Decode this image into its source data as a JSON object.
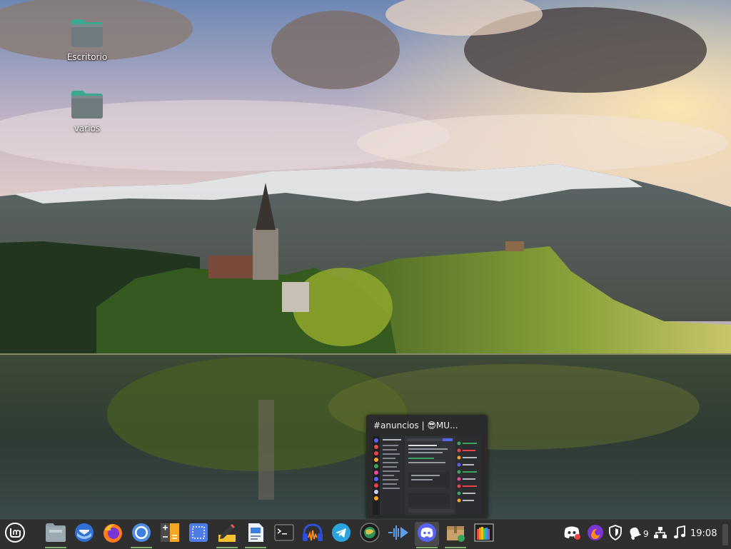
{
  "desktop": {
    "icons": [
      {
        "label": "Escritorio",
        "icon": "folder-icon"
      },
      {
        "label": "varios",
        "icon": "folder-icon"
      }
    ]
  },
  "window_preview": {
    "title": "#anuncios | 😎MU..."
  },
  "panel": {
    "menu": {
      "icon": "linux-mint-menu-icon"
    },
    "launchers": [
      {
        "name": "files",
        "icon": "folder-icon",
        "running": true
      },
      {
        "name": "thunderbird",
        "icon": "thunderbird-icon",
        "running": false
      },
      {
        "name": "firefox",
        "icon": "firefox-icon",
        "running": false
      },
      {
        "name": "chromium",
        "icon": "chromium-icon",
        "running": true
      },
      {
        "name": "calculator",
        "icon": "calculator-icon",
        "running": false
      },
      {
        "name": "screenshot",
        "icon": "screenshot-icon",
        "running": false
      },
      {
        "name": "text-editor",
        "icon": "text-editor-icon",
        "running": true
      },
      {
        "name": "libreoffice-writer",
        "icon": "document-icon",
        "running": true
      },
      {
        "name": "terminal",
        "icon": "terminal-icon",
        "running": false
      },
      {
        "name": "audio",
        "icon": "headphones-icon",
        "running": false
      },
      {
        "name": "telegram",
        "icon": "telegram-icon",
        "running": false
      },
      {
        "name": "steam-like",
        "icon": "globe-icon",
        "running": false
      },
      {
        "name": "media",
        "icon": "media-play-icon",
        "running": false
      },
      {
        "name": "discord",
        "icon": "discord-icon",
        "running": true
      },
      {
        "name": "archive",
        "icon": "package-icon",
        "running": true
      },
      {
        "name": "color-app",
        "icon": "spectrum-icon",
        "running": false
      }
    ],
    "tray": {
      "discord": "discord-tray-icon",
      "firefox": "firefox-tray-icon",
      "security": "shield-icon",
      "notifications": "bell-icon",
      "notification_count": "9",
      "network": "network-icon",
      "sound": "music-note-icon"
    },
    "clock": "19:08"
  },
  "colors": {
    "panel_bg": "#2f2f2f",
    "running_indicator": "#7fb36f",
    "folder_body": "#6f7b7f",
    "folder_tab": "#3aa88f"
  }
}
